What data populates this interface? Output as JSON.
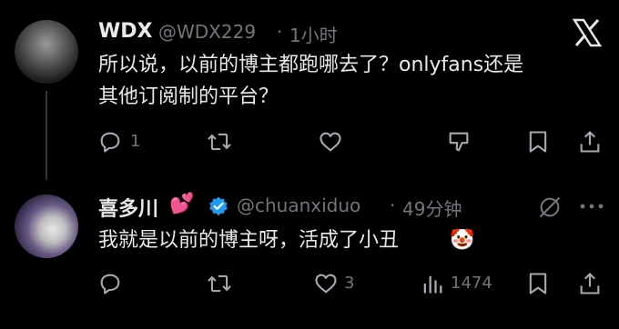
{
  "tweet1": {
    "name": "WDX",
    "handle": "@WDX229",
    "dot": "·",
    "time": "1小时",
    "line1": "所以说，以前的博主都跑哪去了？onlyfans还是",
    "line2": "其他订阅制的平台？",
    "reply_count": "1"
  },
  "tweet2": {
    "name": "喜多川",
    "name_emoji": "💕",
    "handle": "@chuanxiduo",
    "dot": "·",
    "time": "49分钟",
    "text": "我就是以前的博主呀，活成了小丑",
    "text_emoji": "🤡",
    "like_count": "3",
    "view_count": "1474"
  },
  "colors": {
    "background": "#000000",
    "text": "#e7e9ea",
    "muted": "#71767b",
    "verified": "#1d9bf0"
  },
  "icons": [
    "x-logo-icon",
    "grok-icon",
    "reply-icon",
    "retweet-icon",
    "like-icon",
    "downvote-icon",
    "bookmark-icon",
    "share-icon",
    "views-icon",
    "verified-badge-icon"
  ]
}
